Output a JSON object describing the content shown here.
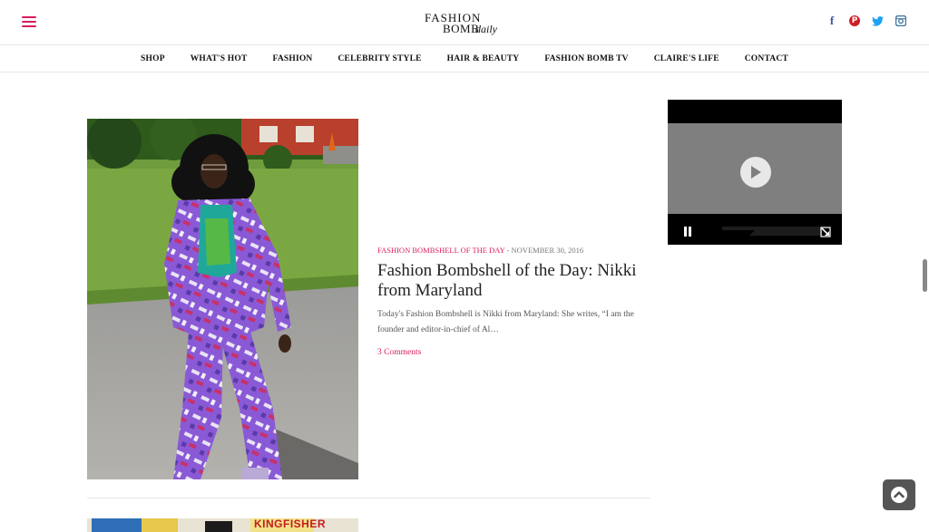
{
  "brand": {
    "line1": "FASHION",
    "line2": "BOMB",
    "line3": "daily"
  },
  "social": [
    {
      "icon": "facebook-icon",
      "glyph": "f",
      "color": "#3b5998"
    },
    {
      "icon": "pinterest-icon",
      "glyph": "P",
      "color": "#cb2027"
    },
    {
      "icon": "twitter-icon",
      "glyph": "t",
      "color": "#1da1f2"
    },
    {
      "icon": "instagram-icon",
      "glyph": "◎",
      "color": "#3f729b"
    }
  ],
  "nav": [
    "SHOP",
    "WHAT'S HOT",
    "FASHION",
    "CELEBRITY STYLE",
    "HAIR & BEAUTY",
    "FASHION BOMB TV",
    "CLAIRE'S LIFE",
    "CONTACT"
  ],
  "post": {
    "category": "FASHION BOMBSHELL OF THE DAY",
    "date_sep": " - ",
    "date": "NOVEMBER 30, 2016",
    "title": "Fashion Bombshell of the Day: Nikki from Maryland",
    "excerpt": "Today's Fashion Bombshell is Nikki from Maryland: She writes, “I am the founder and editor-in-chief of Al…",
    "comments": "3 Comments"
  },
  "next_post": {
    "sign_text": "KINGFISHER"
  },
  "colors": {
    "accent": "#d81b60",
    "text": "#222222",
    "muted": "#777777"
  }
}
